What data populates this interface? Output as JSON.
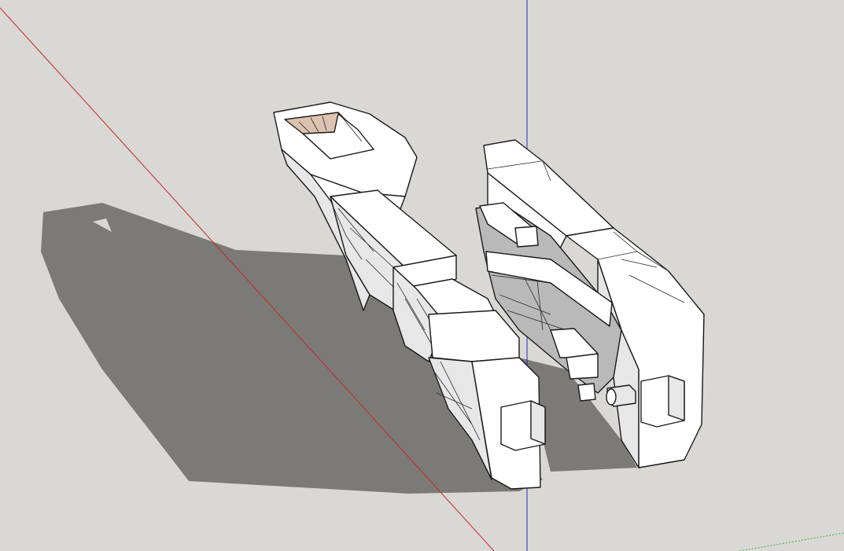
{
  "viewport": {
    "background": "#d9d8d4",
    "shadow_color": "#7b7a77",
    "face_light": "#ffffff",
    "face_mid": "#e7e7e7",
    "face_dark": "#b9b9b9",
    "inner_face": "#dcc3b0"
  },
  "axes": [
    {
      "name": "red-axis",
      "color": "#c8282a"
    },
    {
      "name": "blue-axis",
      "color": "#1e2fbd"
    },
    {
      "name": "green-axis",
      "color": "#4ca64c"
    }
  ],
  "model": {
    "parts": [
      "handle-half",
      "mold-half"
    ]
  }
}
